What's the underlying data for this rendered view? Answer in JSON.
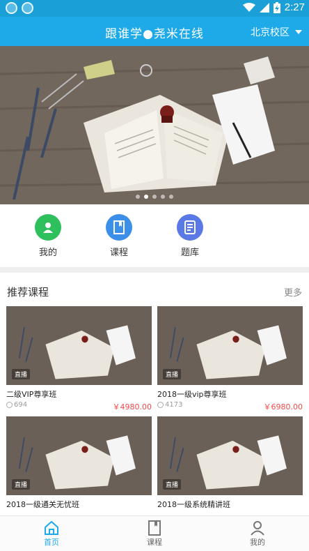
{
  "statusbar": {
    "time": "2:27",
    "battery_icon": "battery-charging-icon",
    "wifi_icon": "wifi-icon",
    "signal_icon": "signal-icon"
  },
  "appbar": {
    "title": "跟谁学●尧米在线",
    "campus": "北京校区"
  },
  "banner": {
    "slide_count": 5,
    "active_slide": 2
  },
  "shortcuts": [
    {
      "label": "我的",
      "icon": "user-icon",
      "color": "#2ec05c"
    },
    {
      "label": "课程",
      "icon": "book-icon",
      "color": "#3c8fe9"
    },
    {
      "label": "题库",
      "icon": "question-bank-icon",
      "color": "#5b79e6"
    }
  ],
  "recommended": {
    "title": "推荐课程",
    "more": "更多",
    "courses": [
      {
        "title": "二级VIP尊享班",
        "viewers": "694",
        "price": "￥4980.00",
        "badge": "直播"
      },
      {
        "title": "2018一级vip尊享班",
        "viewers": "4173",
        "price": "￥6980.00",
        "badge": "直播"
      },
      {
        "title": "2018一级通关无忧班",
        "viewers": "",
        "price": "",
        "badge": "直播"
      },
      {
        "title": "2018一级系统精讲班",
        "viewers": "",
        "price": "",
        "badge": "直播"
      }
    ]
  },
  "tabbar": [
    {
      "label": "首页",
      "icon": "home-icon",
      "active": true
    },
    {
      "label": "课程",
      "icon": "course-icon",
      "active": false
    },
    {
      "label": "我的",
      "icon": "profile-icon",
      "active": false
    }
  ],
  "colors": {
    "primary": "#1eaae8",
    "price": "#f24a4a",
    "statusbar": "#1a9fd6"
  }
}
